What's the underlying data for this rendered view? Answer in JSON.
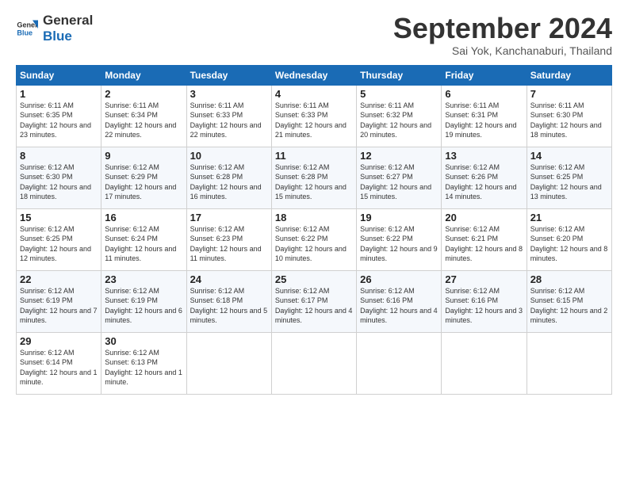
{
  "logo": {
    "line1": "General",
    "line2": "Blue"
  },
  "title": "September 2024",
  "subtitle": "Sai Yok, Kanchanaburi, Thailand",
  "days_header": [
    "Sunday",
    "Monday",
    "Tuesday",
    "Wednesday",
    "Thursday",
    "Friday",
    "Saturday"
  ],
  "weeks": [
    [
      {
        "day": "1",
        "sunrise": "Sunrise: 6:11 AM",
        "sunset": "Sunset: 6:35 PM",
        "daylight": "Daylight: 12 hours and 23 minutes."
      },
      {
        "day": "2",
        "sunrise": "Sunrise: 6:11 AM",
        "sunset": "Sunset: 6:34 PM",
        "daylight": "Daylight: 12 hours and 22 minutes."
      },
      {
        "day": "3",
        "sunrise": "Sunrise: 6:11 AM",
        "sunset": "Sunset: 6:33 PM",
        "daylight": "Daylight: 12 hours and 22 minutes."
      },
      {
        "day": "4",
        "sunrise": "Sunrise: 6:11 AM",
        "sunset": "Sunset: 6:33 PM",
        "daylight": "Daylight: 12 hours and 21 minutes."
      },
      {
        "day": "5",
        "sunrise": "Sunrise: 6:11 AM",
        "sunset": "Sunset: 6:32 PM",
        "daylight": "Daylight: 12 hours and 20 minutes."
      },
      {
        "day": "6",
        "sunrise": "Sunrise: 6:11 AM",
        "sunset": "Sunset: 6:31 PM",
        "daylight": "Daylight: 12 hours and 19 minutes."
      },
      {
        "day": "7",
        "sunrise": "Sunrise: 6:11 AM",
        "sunset": "Sunset: 6:30 PM",
        "daylight": "Daylight: 12 hours and 18 minutes."
      }
    ],
    [
      {
        "day": "8",
        "sunrise": "Sunrise: 6:12 AM",
        "sunset": "Sunset: 6:30 PM",
        "daylight": "Daylight: 12 hours and 18 minutes."
      },
      {
        "day": "9",
        "sunrise": "Sunrise: 6:12 AM",
        "sunset": "Sunset: 6:29 PM",
        "daylight": "Daylight: 12 hours and 17 minutes."
      },
      {
        "day": "10",
        "sunrise": "Sunrise: 6:12 AM",
        "sunset": "Sunset: 6:28 PM",
        "daylight": "Daylight: 12 hours and 16 minutes."
      },
      {
        "day": "11",
        "sunrise": "Sunrise: 6:12 AM",
        "sunset": "Sunset: 6:28 PM",
        "daylight": "Daylight: 12 hours and 15 minutes."
      },
      {
        "day": "12",
        "sunrise": "Sunrise: 6:12 AM",
        "sunset": "Sunset: 6:27 PM",
        "daylight": "Daylight: 12 hours and 15 minutes."
      },
      {
        "day": "13",
        "sunrise": "Sunrise: 6:12 AM",
        "sunset": "Sunset: 6:26 PM",
        "daylight": "Daylight: 12 hours and 14 minutes."
      },
      {
        "day": "14",
        "sunrise": "Sunrise: 6:12 AM",
        "sunset": "Sunset: 6:25 PM",
        "daylight": "Daylight: 12 hours and 13 minutes."
      }
    ],
    [
      {
        "day": "15",
        "sunrise": "Sunrise: 6:12 AM",
        "sunset": "Sunset: 6:25 PM",
        "daylight": "Daylight: 12 hours and 12 minutes."
      },
      {
        "day": "16",
        "sunrise": "Sunrise: 6:12 AM",
        "sunset": "Sunset: 6:24 PM",
        "daylight": "Daylight: 12 hours and 11 minutes."
      },
      {
        "day": "17",
        "sunrise": "Sunrise: 6:12 AM",
        "sunset": "Sunset: 6:23 PM",
        "daylight": "Daylight: 12 hours and 11 minutes."
      },
      {
        "day": "18",
        "sunrise": "Sunrise: 6:12 AM",
        "sunset": "Sunset: 6:22 PM",
        "daylight": "Daylight: 12 hours and 10 minutes."
      },
      {
        "day": "19",
        "sunrise": "Sunrise: 6:12 AM",
        "sunset": "Sunset: 6:22 PM",
        "daylight": "Daylight: 12 hours and 9 minutes."
      },
      {
        "day": "20",
        "sunrise": "Sunrise: 6:12 AM",
        "sunset": "Sunset: 6:21 PM",
        "daylight": "Daylight: 12 hours and 8 minutes."
      },
      {
        "day": "21",
        "sunrise": "Sunrise: 6:12 AM",
        "sunset": "Sunset: 6:20 PM",
        "daylight": "Daylight: 12 hours and 8 minutes."
      }
    ],
    [
      {
        "day": "22",
        "sunrise": "Sunrise: 6:12 AM",
        "sunset": "Sunset: 6:19 PM",
        "daylight": "Daylight: 12 hours and 7 minutes."
      },
      {
        "day": "23",
        "sunrise": "Sunrise: 6:12 AM",
        "sunset": "Sunset: 6:19 PM",
        "daylight": "Daylight: 12 hours and 6 minutes."
      },
      {
        "day": "24",
        "sunrise": "Sunrise: 6:12 AM",
        "sunset": "Sunset: 6:18 PM",
        "daylight": "Daylight: 12 hours and 5 minutes."
      },
      {
        "day": "25",
        "sunrise": "Sunrise: 6:12 AM",
        "sunset": "Sunset: 6:17 PM",
        "daylight": "Daylight: 12 hours and 4 minutes."
      },
      {
        "day": "26",
        "sunrise": "Sunrise: 6:12 AM",
        "sunset": "Sunset: 6:16 PM",
        "daylight": "Daylight: 12 hours and 4 minutes."
      },
      {
        "day": "27",
        "sunrise": "Sunrise: 6:12 AM",
        "sunset": "Sunset: 6:16 PM",
        "daylight": "Daylight: 12 hours and 3 minutes."
      },
      {
        "day": "28",
        "sunrise": "Sunrise: 6:12 AM",
        "sunset": "Sunset: 6:15 PM",
        "daylight": "Daylight: 12 hours and 2 minutes."
      }
    ],
    [
      {
        "day": "29",
        "sunrise": "Sunrise: 6:12 AM",
        "sunset": "Sunset: 6:14 PM",
        "daylight": "Daylight: 12 hours and 1 minute."
      },
      {
        "day": "30",
        "sunrise": "Sunrise: 6:12 AM",
        "sunset": "Sunset: 6:13 PM",
        "daylight": "Daylight: 12 hours and 1 minute."
      },
      null,
      null,
      null,
      null,
      null
    ]
  ]
}
